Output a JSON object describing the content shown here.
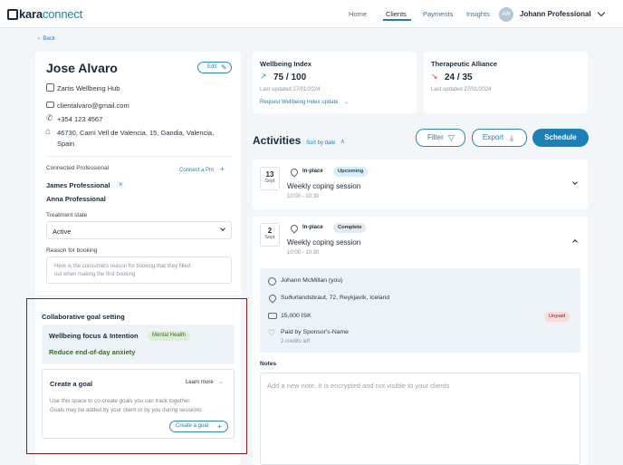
{
  "header": {
    "logo_brand": "kara",
    "logo_suffix": "connect",
    "nav": [
      {
        "label": "Home"
      },
      {
        "label": "Clients"
      },
      {
        "label": "Payments"
      },
      {
        "label": "Insights"
      }
    ],
    "user_initials": "AW",
    "user_name": "Johann Professional"
  },
  "back_label": "Back",
  "client": {
    "name": "Jose Alvaro",
    "edit_label": "Edit",
    "organisation": "Zartis Wellbeing Hub",
    "email": "clientalvaro@gmail.com",
    "phone": "+354 123 4567",
    "address_line1": "46730, Camí Vell de Valencia, 15, Gandia, Valencia,",
    "address_line2": "Spain"
  },
  "connected": {
    "label": "Connected Professional",
    "connect_link": "Connect a Pro",
    "professionals": [
      "James Professional",
      "Anna Professional"
    ]
  },
  "treatment": {
    "label": "Treatment state",
    "value": "Active"
  },
  "booking": {
    "label": "Reason for booking",
    "placeholder_line1": "Here is the consumers reason for booking that they filled",
    "placeholder_line2": "out when making the first booking"
  },
  "goals": {
    "title": "Collaborative goal setting",
    "focus_title": "Wellbeing focus & Intention",
    "focus_tag": "Mental Health",
    "focus_text": "Reduce end-of-day anxiety",
    "create_title": "Create a goal",
    "learn_more": "Learn more",
    "desc_line1": "Use this space to co-create goals you can track together.",
    "desc_line2": "Goals may be added by your client or by you during sessions.",
    "create_button": "Create a goal"
  },
  "wellbeing": {
    "title": "Wellbeing Index",
    "score": "75 / 100",
    "updated": "Last updated 27/01/2024",
    "request_link": "Request Wellbeing Index update"
  },
  "alliance": {
    "title": "Therapeutic Alliance",
    "score": "24 / 35",
    "updated": "Last updated 27/01/2024"
  },
  "activities": {
    "title": "Activities",
    "sort_label": "Sort by date",
    "filter_label": "Filter",
    "export_label": "Export",
    "schedule_label": "Schedule",
    "items": [
      {
        "day": "13",
        "month": "Sept",
        "mode": "In-place",
        "status": "Upcoming",
        "title": "Weekly coping session",
        "time": "10:00 - 10:30"
      },
      {
        "day": "2",
        "month": "Sept",
        "mode": "In-place",
        "status": "Complete",
        "title": "Weekly coping session",
        "time": "10:00 - 10:30",
        "details": {
          "person": "Johann McMillan (you)",
          "location": "Suðurlandsbraut, 72, Reykjavík, Iceland",
          "price": "15,000 ISK",
          "payment_status": "Unpaid",
          "sponsor": "Paid by Sponsor's-Name",
          "credits": "2 credits left"
        }
      }
    ]
  },
  "notes": {
    "label": "Notes",
    "placeholder": "Add a new note. It is encrypted and not visible to your clients"
  },
  "colors": {
    "accent": "#1c7fb8",
    "highlight_border": "#8b1c1c",
    "up_trend": "#2aa374",
    "down_trend": "#d23c3c"
  }
}
